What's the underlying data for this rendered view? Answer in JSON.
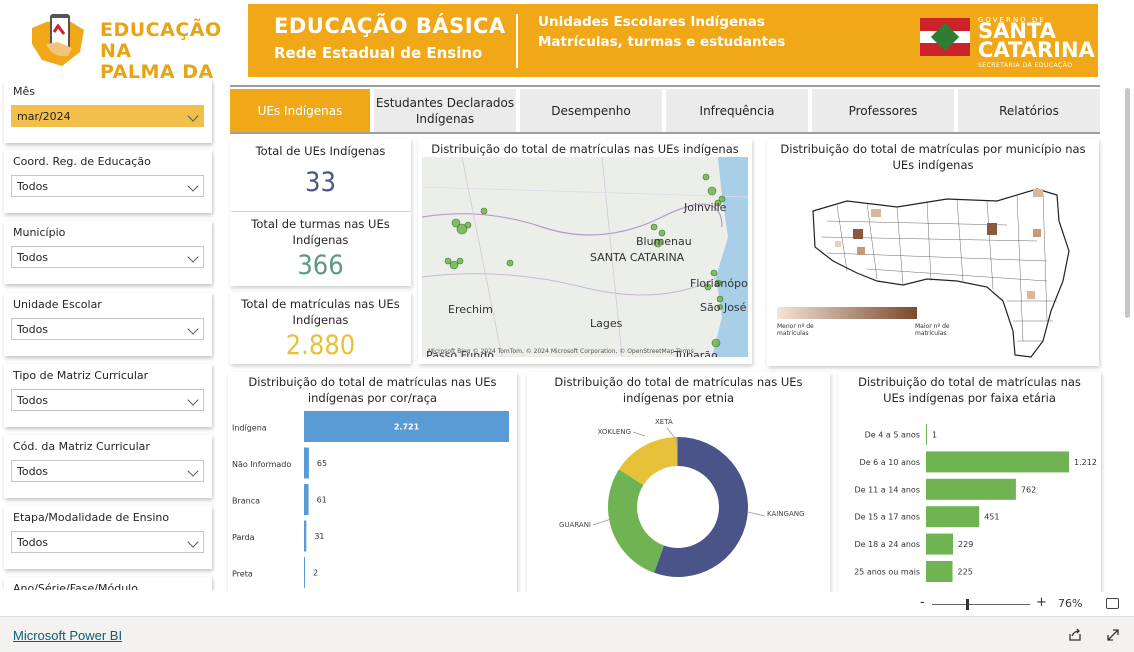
{
  "banner": {
    "logo_line1": "EDUCAÇÃO NA",
    "logo_line2": "PALMA DA MÃO",
    "title": "EDUCAÇÃO BÁSICA",
    "subtitle": "Rede Estadual de Ensino",
    "description": "Unidades Escolares Indígenas Matrículas, turmas  e estudantes",
    "gov_small": "GOVERNO DE",
    "gov_line1": "SANTA",
    "gov_line2": "CATARINA",
    "gov_foot": "SECRETARIA DA EDUCAÇÃO"
  },
  "filters": [
    {
      "label": "Mês",
      "value": "mar/2024",
      "active": true
    },
    {
      "label": "Coord. Reg. de Educação",
      "value": "Todos"
    },
    {
      "label": "Município",
      "value": "Todos"
    },
    {
      "label": "Unidade Escolar",
      "value": "Todos"
    },
    {
      "label": "Tipo de Matriz Curricular",
      "value": "Todos"
    },
    {
      "label": "Cód. da Matriz Curricular",
      "value": "Todos"
    },
    {
      "label": "Etapa/Modalidade de Ensino",
      "value": "Todos"
    },
    {
      "label": "Ano/Série/Fase/Módulo",
      "value": ""
    }
  ],
  "tabs": [
    {
      "label": "UEs Indígenas"
    },
    {
      "label": "Estudantes Declarados Indígenas"
    },
    {
      "label": "Desempenho"
    },
    {
      "label": "Infrequência"
    },
    {
      "label": "Professores"
    },
    {
      "label": "Relatórios"
    }
  ],
  "kpis": {
    "ues": {
      "title": "Total de UEs Indígenas",
      "value": "33",
      "color": "#4a5488"
    },
    "turmas": {
      "title": "Total de turmas nas UEs Indígenas",
      "value": "366",
      "color": "#5e9a82"
    },
    "matriculas": {
      "title": "Total de matrículas nas UEs Indígenas",
      "value": "2.880",
      "color": "#e8c13a"
    }
  },
  "map_ues": {
    "title": "Distribuição do total de matrículas nas UEs indígenas",
    "labels": [
      "Joinville",
      "Blumenau",
      "SANTA CATARINA",
      "Florianópolis",
      "São José",
      "Erechim",
      "Lages",
      "Passo Fundo",
      "Tubarão"
    ],
    "attribution": "© 2024 TomTom, © 2024 Microsoft Corporation, © OpenStreetMap  Terms",
    "provider": "Microsoft Bing"
  },
  "map_mun": {
    "title": "Distribuição do total de matrículas por município nas UEs indígenas",
    "legend_min": "Menor nº de matrículas",
    "legend_max": "Maior nº de matrículas"
  },
  "colors": {
    "accent": "#f0a818",
    "bar_blue": "#5b9bd5",
    "bar_green": "#6fb352",
    "donut_navy": "#4a5488",
    "donut_green": "#6fb352",
    "donut_yellow": "#e8c13a"
  },
  "chart_data": [
    {
      "type": "bar",
      "title": "Distribuição do total de matrículas nas UEs indígenas por cor/raça",
      "categories": [
        "Indígena",
        "Não Informado",
        "Branca",
        "Parda",
        "Preta"
      ],
      "values": [
        2721,
        65,
        61,
        31,
        2
      ],
      "value_labels": [
        "2.721",
        "65",
        "61",
        "31",
        "2"
      ]
    },
    {
      "type": "pie",
      "title": "Distribuição do total de matrículas nas UEs indígenas por etnia",
      "categories": [
        "KAINGANG",
        "GUARANI",
        "XOKLENG",
        "XETÁ"
      ],
      "values": [
        1600,
        820,
        450,
        10
      ]
    },
    {
      "type": "bar",
      "title": "Distribuição do total de matrículas nas UEs indígenas por faixa etária",
      "categories": [
        "De 4 a 5 anos",
        "De 6 a 10 anos",
        "De 11 a 14 anos",
        "De 15 a 17 anos",
        "De 18 a 24 anos",
        "25 anos ou mais"
      ],
      "values": [
        1,
        1212,
        762,
        451,
        229,
        225
      ],
      "value_labels": [
        "1",
        "1.212",
        "762",
        "451",
        "229",
        "225"
      ]
    }
  ],
  "zoom": {
    "minus": "-",
    "plus": "+",
    "level": "76%"
  },
  "footer": {
    "link": "Microsoft Power BI"
  }
}
